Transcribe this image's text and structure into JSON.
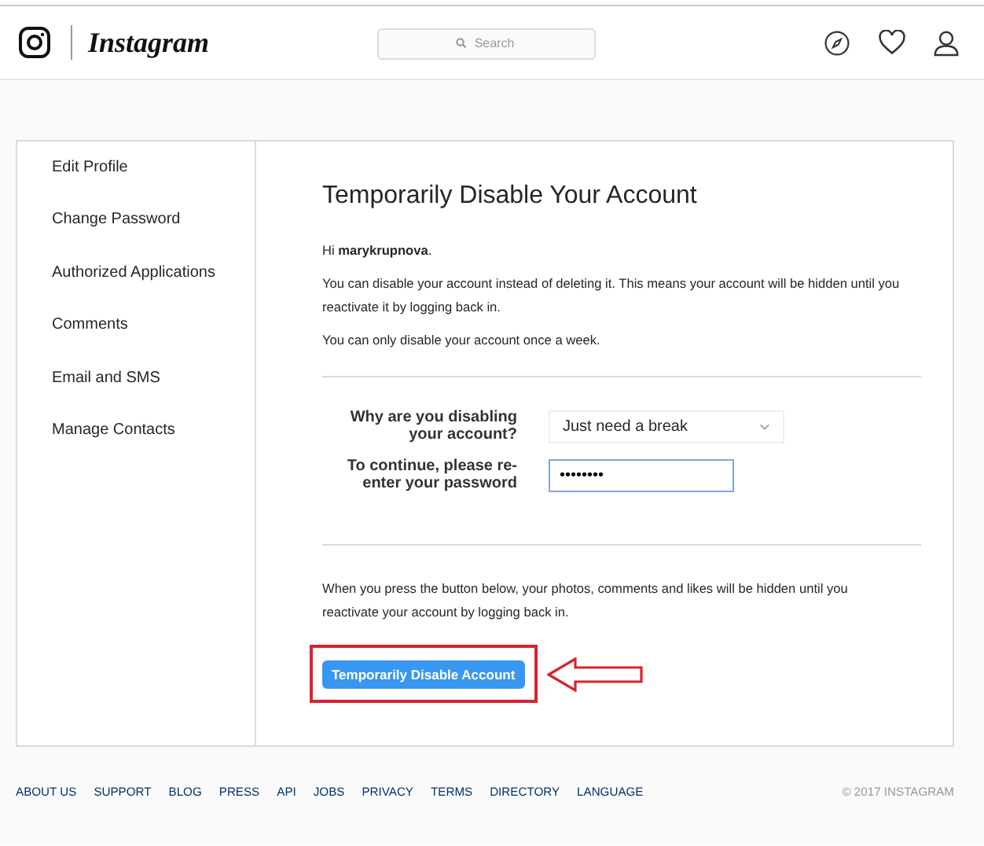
{
  "header": {
    "brand": "Instagram",
    "search": {
      "placeholder": "Search"
    }
  },
  "sidebar": {
    "items": [
      {
        "label": "Edit Profile",
        "selected": false
      },
      {
        "label": "Change Password",
        "selected": false
      },
      {
        "label": "Authorized Applications",
        "selected": false
      },
      {
        "label": "Comments",
        "selected": false
      },
      {
        "label": "Email and SMS",
        "selected": false
      },
      {
        "label": "Manage Contacts",
        "selected": false
      }
    ]
  },
  "main": {
    "title": "Temporarily Disable Your Account",
    "greeting": "Hi **marykrupnova**.",
    "paragraphs": [
      "You can disable your account instead of deleting it. This means your account will be hidden until you reactivate it by logging back in.",
      "You can only disable your account once a week."
    ],
    "form": [
      {
        "kind": "select",
        "label": "Why are you disabling your account?",
        "value": "Just need a break"
      },
      {
        "kind": "password",
        "label": "To continue, please re-enter your password",
        "value": "••••••••",
        "focused": true
      }
    ],
    "notice": "When you press the button below, your photos, comments and likes will be hidden until you reactivate your account by logging back in.",
    "button": "Temporarily Disable Account"
  },
  "footer": {
    "links": [
      "ABOUT US",
      "SUPPORT",
      "BLOG",
      "PRESS",
      "API",
      "JOBS",
      "PRIVACY",
      "TERMS",
      "DIRECTORY",
      "LANGUAGE"
    ],
    "copyright": "© 2017 INSTAGRAM"
  }
}
